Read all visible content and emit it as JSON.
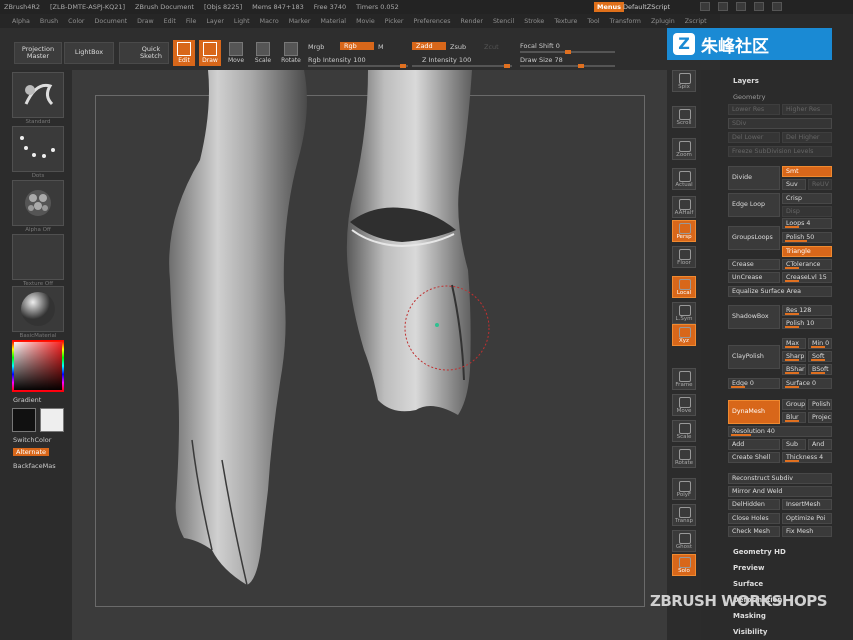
{
  "titlebar": {
    "items": [
      "ZBrush4R2",
      "[ZLB-DMTE-ASPJ-KQ21]",
      "ZBrush Document",
      "[Objs 8225]",
      "Mems 847+183",
      "Free 3740",
      "Timers 0.052"
    ],
    "menus_label": "Menus",
    "script_label": "DefaultZScript"
  },
  "menubar": {
    "items": [
      "Alpha",
      "Brush",
      "Color",
      "Document",
      "Draw",
      "Edit",
      "File",
      "Layer",
      "Light",
      "Macro",
      "Marker",
      "Material",
      "Movie",
      "Picker",
      "Preferences",
      "Render",
      "Stencil",
      "Stroke",
      "Texture",
      "Tool",
      "Transform",
      "Zplugin",
      "Zscript"
    ]
  },
  "toolbar": {
    "projection_master": "Projection Master",
    "lightbox": "LightBox",
    "quick_sketch": "Quick Sketch",
    "edit": "Edit",
    "draw": "Draw",
    "move": "Move",
    "scale": "Scale",
    "rotate": "Rotate",
    "mrgb": "Mrgb",
    "rgb": "Rgb",
    "m": "M",
    "zadd": "Zadd",
    "zsub": "Zsub",
    "zcut": "Zcut",
    "focal_shift_label": "Focal Shift",
    "focal_shift_value": "0",
    "rgb_intensity_label": "Rgb Intensity",
    "rgb_intensity_value": "100",
    "z_intensity_label": "Z Intensity",
    "z_intensity_value": "100",
    "draw_size_label": "Draw Size",
    "draw_size_value": "78"
  },
  "leftshelf": {
    "brush_label": "Standard",
    "stroke_label": "Dots",
    "alpha_label": "Alpha Off",
    "texture_label": "Texture Off",
    "material_label": "BasicMaterial",
    "gradient_label": "Gradient",
    "switchcolor_label": "SwitchColor",
    "alternate_label": "Alternate",
    "backface_label": "BackfaceMas"
  },
  "righticons": [
    "Spix",
    "Scroll",
    "Zoom",
    "Actual",
    "AAHalf",
    "Persp",
    "Floor",
    "Local",
    "L.Sym",
    "Xyz",
    "Frame",
    "Move",
    "Scale",
    "Rotate",
    "PolyF",
    "Transp",
    "Ghost",
    "Solo"
  ],
  "rpanel": {
    "layers": "Layers",
    "geometry": "Geometry",
    "lower_res": "Lower Res",
    "higher_res": "Higher Res",
    "sdiv": "SDiv",
    "del_lower": "Del Lower",
    "del_higher": "Del Higher",
    "freeze": "Freeze SubDivision Levels",
    "divide": "Divide",
    "smt": "Smt",
    "suv": "Suv",
    "reuv": "ReUV",
    "edge_loop": "Edge Loop",
    "crisp": "Crisp",
    "disp": "Disp",
    "groups_loops": "GroupsLoops",
    "loops": "Loops 4",
    "polish": "Polish 50",
    "triangle": "Triangle",
    "crease": "Crease",
    "ctolerance": "CTolerance",
    "uncrease": "UnCrease",
    "creaselvl": "CreaseLvl 15",
    "equalize": "Equalize Surface Area",
    "shadowbox": "ShadowBox",
    "res128": "Res 128",
    "polish10": "Polish 10",
    "claypolish": "ClayPolish",
    "max": "Max",
    "min": "Min 0",
    "sharp": "Sharp",
    "soft": "Soft",
    "bshar": "BShar",
    "bsoft": "BSoft",
    "edge": "Edge 0",
    "surface": "Surface 0",
    "dynamesh": "DynaMesh",
    "group": "Group",
    "polish2": "Polish",
    "blur": "Blur",
    "project": "Projec",
    "resolution": "Resolution 40",
    "add": "Add",
    "sub": "Sub",
    "and": "And",
    "create_shell": "Create Shell",
    "thickness": "Thickness 4",
    "reconstruct": "Reconstruct Subdiv",
    "mirror_weld": "Mirror And Weld",
    "delhidden": "DelHidden",
    "insertmesh": "InsertMesh",
    "close_holes": "Close Holes",
    "optimize": "Optimize Poi",
    "check_mesh": "Check Mesh",
    "fix_mesh": "Fix Mesh",
    "geometry_hd": "Geometry HD",
    "preview": "Preview",
    "surface_sec": "Surface",
    "deformation": "Deformation",
    "masking": "Masking",
    "visibility": "Visibility"
  },
  "watermarks": {
    "top_logo": "Z",
    "top_text": "朱峰社区",
    "bottom_text": "ZBRUSH WORKSHOPS"
  },
  "colors": {
    "accent": "#d8671a",
    "canvas": "#3b3b3b",
    "panel": "#2b2b2b"
  }
}
